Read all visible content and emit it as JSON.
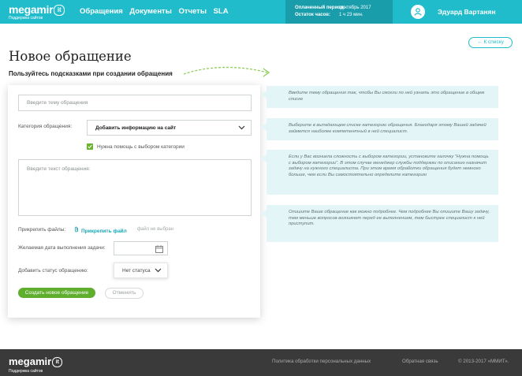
{
  "header": {
    "logo_text": "megamir",
    "logo_badge": "it",
    "logo_subtitle": "Поддержка сайтов",
    "nav": [
      "Обращения",
      "Документы",
      "Отчеты",
      "SLA"
    ],
    "period_label": "Оплаченный период:",
    "period_value": "сентябрь 2017",
    "hours_label": "Остаток часов:",
    "hours_value": "1 ч 23 мин.",
    "user_name": "Эдуард Вартанян"
  },
  "back_label": "← К списку",
  "page_title": "Новое обращение",
  "page_subtitle": "Пользуйтесь подсказками при создании обращения",
  "form": {
    "topic_placeholder": "Введите тему обращения",
    "category_label": "Категория обращения:",
    "category_value": "Добавить информацию на сайт",
    "help_checkbox_label": "Нужна помощь с выбором категории",
    "text_placeholder": "Введите текст обращения:",
    "attach_label": "Прикрепить файлы:",
    "attach_link": "Прикрепить файл",
    "file_status": "файл не выбран",
    "date_label": "Желаемая дата выполнения задачи:",
    "status_label": "Добавить статус обращению:",
    "status_value": "Нет статуса",
    "submit_label": "Создать новое обращение",
    "cancel_label": "Отменить"
  },
  "hints": [
    "Введите тему обращения так, чтобы Вы смогли по ней узнать это обращение в общем списке",
    "Выберите в выпадающем списке категорию обращения. Благодаря этому Вашей задачей займется наиболее компетентный в ней специалист.",
    "Если у Вас возникла сложность с выбором категории, установите галочку \"Нужна помощь с выбором категории\". В этом случае менеджер службы поддержки по описанию назначит задачу на нужного специалиста. При этом время обработки обращения будет немного больше, чем если Вы самостоятельно определите категорию",
    "Опишите Ваше обращение как можно подробнее. Чем подробнее Вы опишите Вашу задачу, тем меньше вопросов возникнет перед ее выполнением, тем быстрее специалист к ней приступит."
  ],
  "footer": {
    "logo_text": "megamir",
    "logo_badge": "it",
    "logo_subtitle": "Поддержка сайтов",
    "privacy": "Политика обработки персональных данных",
    "feedback": "Обратная связь",
    "copyright": "© 2013-2017 «ММИТ»."
  },
  "colors": {
    "header": "#20bccb",
    "header_dark": "#1a9dab",
    "primary_button": "#5fae2e",
    "hint_bg": "#e4f5f8",
    "footer": "#3a3a3a"
  }
}
